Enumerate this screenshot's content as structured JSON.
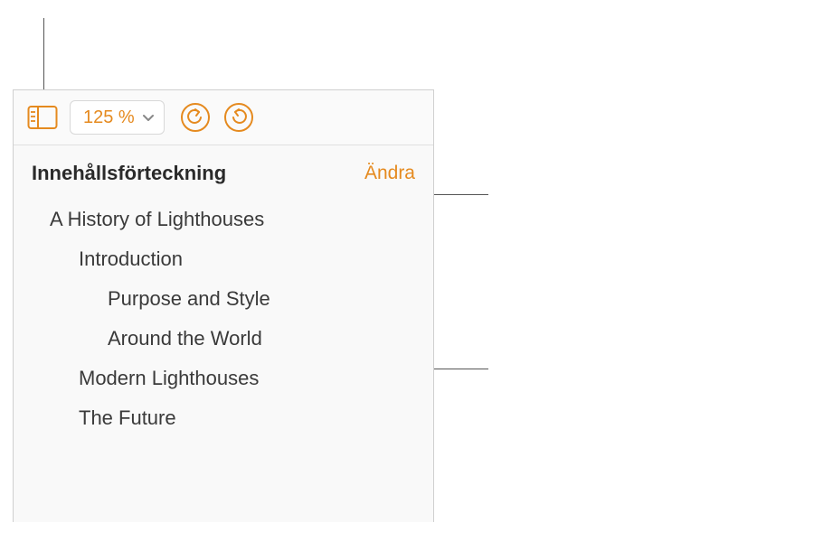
{
  "toolbar": {
    "zoom_value": "125 %"
  },
  "colors": {
    "accent": "#e58a1f"
  },
  "toc": {
    "title": "Innehållsförteckning",
    "edit_label": "Ändra",
    "items": [
      {
        "label": "A History of Lighthouses",
        "level": 0
      },
      {
        "label": "Introduction",
        "level": 1
      },
      {
        "label": "Purpose and Style",
        "level": 2
      },
      {
        "label": "Around the World",
        "level": 2
      },
      {
        "label": "Modern Lighthouses",
        "level": 1
      },
      {
        "label": "The Future",
        "level": 1
      }
    ]
  }
}
